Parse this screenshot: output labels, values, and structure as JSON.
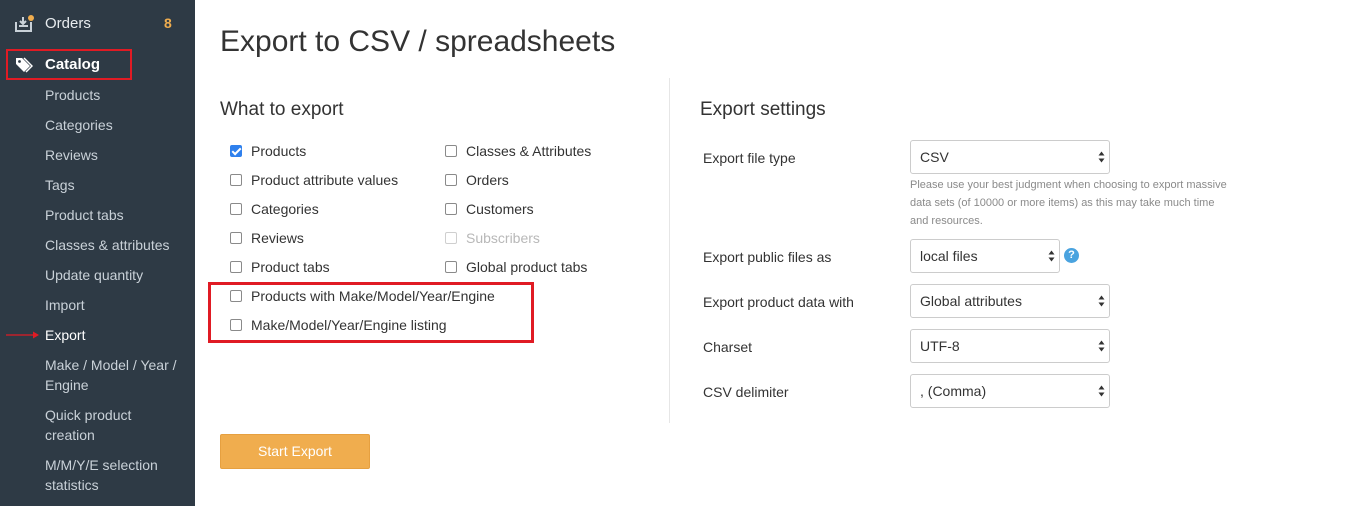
{
  "sidebar": {
    "orders": {
      "label": "Orders",
      "count": "8",
      "icon": "inbox-icon"
    },
    "catalog": {
      "label": "Catalog",
      "icon": "tags-icon"
    },
    "items": [
      {
        "label": "Products"
      },
      {
        "label": "Categories"
      },
      {
        "label": "Reviews"
      },
      {
        "label": "Tags"
      },
      {
        "label": "Product tabs"
      },
      {
        "label": "Classes & attributes"
      },
      {
        "label": "Update quantity"
      },
      {
        "label": "Import"
      },
      {
        "label": "Export",
        "active": true
      },
      {
        "label": "Make / Model / Year / Engine"
      },
      {
        "label": "Quick product creation"
      },
      {
        "label": "M/M/Y/E selection statistics"
      }
    ]
  },
  "page": {
    "title": "Export to CSV / spreadsheets"
  },
  "what_to_export": {
    "title": "What to export",
    "left": [
      {
        "label": "Products",
        "checked": true
      },
      {
        "label": "Product attribute values",
        "checked": false
      },
      {
        "label": "Categories",
        "checked": false
      },
      {
        "label": "Reviews",
        "checked": false
      },
      {
        "label": "Product tabs",
        "checked": false
      },
      {
        "label": "Products with Make/Model/Year/Engine",
        "checked": false
      },
      {
        "label": "Make/Model/Year/Engine listing",
        "checked": false
      }
    ],
    "right": [
      {
        "label": "Classes & Attributes",
        "checked": false
      },
      {
        "label": "Orders",
        "checked": false
      },
      {
        "label": "Customers",
        "checked": false
      },
      {
        "label": "Subscribers",
        "checked": false,
        "disabled": true
      },
      {
        "label": "Global product tabs",
        "checked": false
      }
    ]
  },
  "settings": {
    "title": "Export settings",
    "file_type": {
      "label": "Export file type",
      "value": "CSV"
    },
    "help": "Please use your best judgment when choosing to export massive data sets (of 10000 or more items) as this may take much time and resources.",
    "public_files": {
      "label": "Export public files as",
      "value": "local files",
      "help_icon": "?"
    },
    "product_data": {
      "label": "Export product data with",
      "value": "Global attributes"
    },
    "charset": {
      "label": "Charset",
      "value": "UTF-8"
    },
    "delimiter": {
      "label": "CSV delimiter",
      "value": ", (Comma)"
    }
  },
  "actions": {
    "start_export": "Start Export"
  },
  "colors": {
    "sidebar_bg": "#2e3a45",
    "accent": "#f0ad4e",
    "highlight": "#e01b24",
    "checkbox": "#2f80ed"
  }
}
